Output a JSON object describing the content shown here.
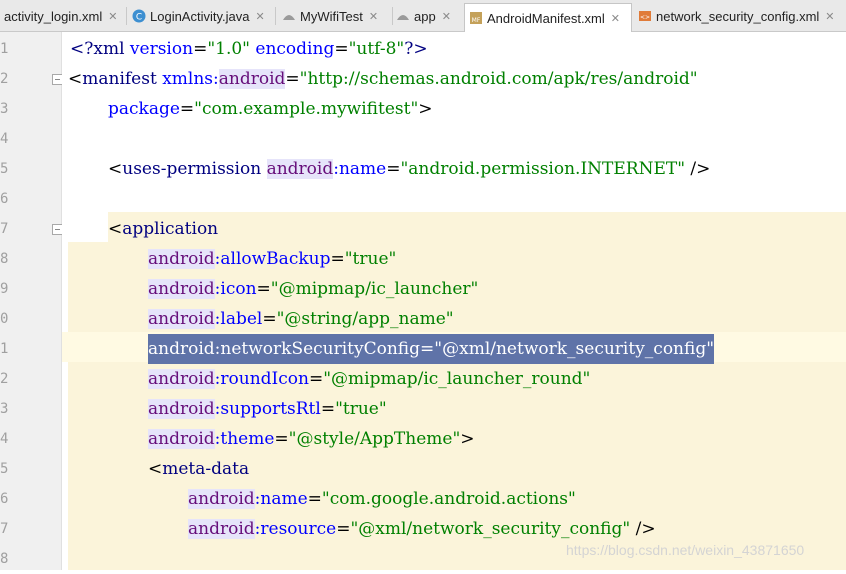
{
  "tabs": [
    {
      "label": "activity_login.xml",
      "icon": "xml-file-icon"
    },
    {
      "label": "LoginActivity.java",
      "icon": "java-class-icon"
    },
    {
      "label": "MyWifiTest",
      "icon": "android-icon"
    },
    {
      "label": "app",
      "icon": "android-icon"
    },
    {
      "label": "AndroidManifest.xml",
      "icon": "manifest-file-icon",
      "active": true
    },
    {
      "label": "network_security_config.xml",
      "icon": "xml-file-icon"
    }
  ],
  "line_numbers": [
    "1",
    "2",
    "3",
    "4",
    "5",
    "6",
    "7",
    "8",
    "9",
    "0",
    "1",
    "2",
    "3",
    "4",
    "5",
    "6",
    "7",
    "8"
  ],
  "code": {
    "l1": {
      "a": "<?xml ",
      "b": "version",
      "c": "=",
      "d": "\"1.0\"",
      "e": " ",
      "f": "encoding",
      "g": "=",
      "h": "\"utf-8\"",
      "i": "?>"
    },
    "l2": {
      "a": "<",
      "b": "manifest ",
      "c": "xmlns:",
      "d": "android",
      "e": "=",
      "f": "\"http://schemas.android.com/apk/res/android\""
    },
    "l3": {
      "a": "package",
      "b": "=",
      "c": "\"com.example.mywifitest\"",
      "d": ">"
    },
    "l5": {
      "a": "<",
      "b": "uses-permission ",
      "c": "android",
      "d": ":",
      "e": "name",
      "f": "=",
      "g": "\"android.permission.INTERNET\"",
      "h": " />"
    },
    "l7": {
      "a": "<",
      "b": "application"
    },
    "l8": {
      "ns": "android",
      "colon": ":",
      "attr": "allowBackup",
      "eq": "=",
      "val": "\"true\""
    },
    "l9": {
      "ns": "android",
      "colon": ":",
      "attr": "icon",
      "eq": "=",
      "val": "\"@mipmap/ic_launcher\""
    },
    "l10": {
      "ns": "android",
      "colon": ":",
      "attr": "label",
      "eq": "=",
      "val": "\"@string/app_name\""
    },
    "l11": {
      "ns": "android",
      "colon": ":",
      "attr": "networkSecurityConfig",
      "eq": "=",
      "val": "\"@xml/network_security_config\""
    },
    "l12": {
      "ns": "android",
      "colon": ":",
      "attr": "roundIcon",
      "eq": "=",
      "val": "\"@mipmap/ic_launcher_round\""
    },
    "l13": {
      "ns": "android",
      "colon": ":",
      "attr": "supportsRtl",
      "eq": "=",
      "val": "\"true\""
    },
    "l14": {
      "ns": "android",
      "colon": ":",
      "attr": "theme",
      "eq": "=",
      "val": "\"@style/AppTheme\"",
      "end": ">"
    },
    "l15": {
      "a": "<",
      "b": "meta-data"
    },
    "l16": {
      "ns": "android",
      "colon": ":",
      "attr": "name",
      "eq": "=",
      "val": "\"com.google.android.actions\""
    },
    "l17": {
      "ns": "android",
      "colon": ":",
      "attr": "resource",
      "eq": "=",
      "val": "\"@xml/network_security_config\"",
      "end": " />"
    }
  },
  "watermark": "https://blog.csdn.net/weixin_43871650",
  "colors": {
    "tag": "#000080",
    "attribute": "#0000ff",
    "namespace": "#660e7a",
    "string": "#008000",
    "selection": "#5f73a8",
    "scope_highlight": "#fbf4da"
  }
}
